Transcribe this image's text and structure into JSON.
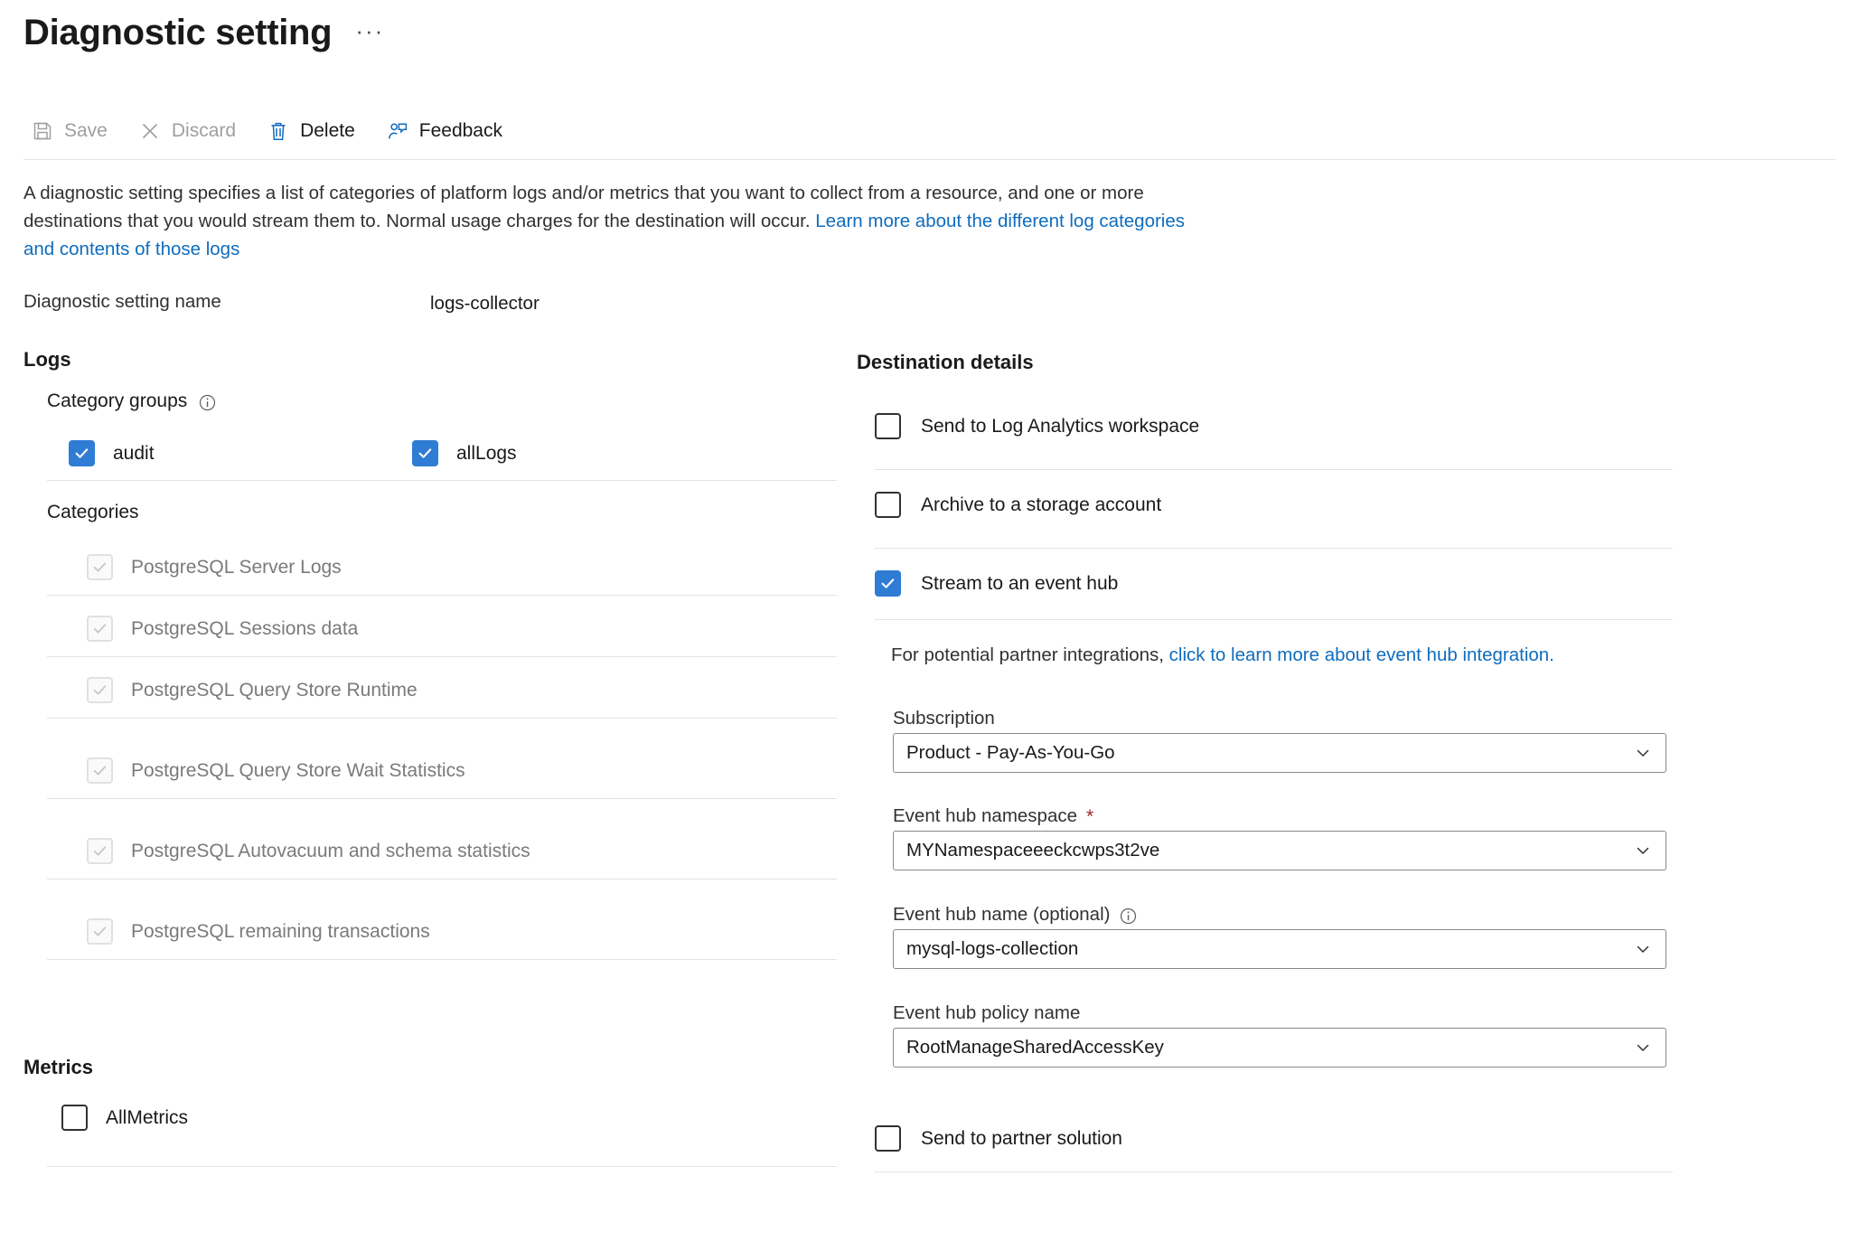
{
  "header": {
    "title": "Diagnostic setting",
    "more_label": "···"
  },
  "toolbar": {
    "save_label": "Save",
    "discard_label": "Discard",
    "delete_label": "Delete",
    "feedback_label": "Feedback"
  },
  "description": {
    "part1": "A diagnostic setting specifies a list of categories of platform logs and/or metrics that you want to collect from a resource, and one or more destinations that you would stream them to. Normal usage charges for the destination will occur. ",
    "link": "Learn more about the different log categories and contents of those logs"
  },
  "setting_name": {
    "label": "Diagnostic setting name",
    "value": "logs-collector"
  },
  "logs": {
    "heading": "Logs",
    "category_groups_heading": "Category groups",
    "category_groups_info_icon": "info-icon",
    "category_groups": [
      {
        "label": "audit",
        "checked": true
      },
      {
        "label": "allLogs",
        "checked": true
      }
    ],
    "categories_heading": "Categories",
    "categories": [
      {
        "label": "PostgreSQL Server Logs",
        "checked": true,
        "disabled": true
      },
      {
        "label": "PostgreSQL Sessions data",
        "checked": true,
        "disabled": true
      },
      {
        "label": "PostgreSQL Query Store Runtime",
        "checked": true,
        "disabled": true
      },
      {
        "label": "PostgreSQL Query Store Wait Statistics",
        "checked": true,
        "disabled": true
      },
      {
        "label": "PostgreSQL Autovacuum and schema statistics",
        "checked": true,
        "disabled": true
      },
      {
        "label": "PostgreSQL remaining transactions",
        "checked": true,
        "disabled": true
      }
    ]
  },
  "metrics": {
    "heading": "Metrics",
    "items": [
      {
        "label": "AllMetrics",
        "checked": false
      }
    ]
  },
  "destination": {
    "heading": "Destination details",
    "options": [
      {
        "label": "Send to Log Analytics workspace",
        "checked": false
      },
      {
        "label": "Archive to a storage account",
        "checked": false
      },
      {
        "label": "Stream to an event hub",
        "checked": true
      },
      {
        "label": "Send to partner solution",
        "checked": false
      }
    ],
    "partner_note_prefix": "For potential partner integrations, ",
    "partner_note_link": "click to learn more about event hub integration.",
    "fields": [
      {
        "label": "Subscription",
        "required": false,
        "has_info": false,
        "value": "Product - Pay-As-You-Go"
      },
      {
        "label": "Event hub namespace",
        "required": true,
        "has_info": false,
        "value": "MYNamespaceeeckcwps3t2ve"
      },
      {
        "label": "Event hub name (optional)",
        "required": false,
        "has_info": true,
        "value": "mysql-logs-collection"
      },
      {
        "label": "Event hub policy name",
        "required": false,
        "has_info": false,
        "value": "RootManageSharedAccessKey"
      }
    ]
  },
  "colors": {
    "accent_blue": "#2f7cd4",
    "link_blue": "#0f6cbd",
    "icon_blue": "#0f6cbd",
    "required_red": "#a4262c",
    "disabled_grey": "#a19f9d",
    "muted_text": "#7a7a7a"
  }
}
